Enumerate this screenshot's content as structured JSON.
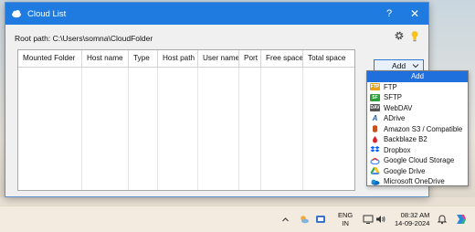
{
  "window": {
    "title": "Cloud List",
    "help_label": "?",
    "close_label": "✕"
  },
  "root_path": "Root path: C:\\Users\\somna\\CloudFolder",
  "table": {
    "columns": [
      "Mounted Folder",
      "Host name",
      "Type",
      "Host path",
      "User name",
      "Port",
      "Free space",
      "Total space"
    ]
  },
  "add_button": {
    "label": "Add"
  },
  "dropdown": {
    "items": [
      {
        "label": "Add",
        "icon": "none",
        "selected": true
      },
      {
        "label": "FTP",
        "icon": "ftp-icon",
        "color": "#e8a317"
      },
      {
        "label": "SFTP",
        "icon": "sftp-icon",
        "color": "#2e9e3a"
      },
      {
        "label": "WebDAV",
        "icon": "webdav-icon",
        "color": "#555555"
      },
      {
        "label": "ADrive",
        "icon": "adrive-icon",
        "color": "#1a5fb4"
      },
      {
        "label": "Amazon S3 / Compatible",
        "icon": "amazon-s3-icon",
        "color": "#c7511f"
      },
      {
        "label": "Backblaze B2",
        "icon": "backblaze-icon",
        "color": "#d9252a"
      },
      {
        "label": "Dropbox",
        "icon": "dropbox-icon",
        "color": "#0061fe"
      },
      {
        "label": "Google Cloud Storage",
        "icon": "google-cloud-icon",
        "color": "#4285f4"
      },
      {
        "label": "Google Drive",
        "icon": "google-drive-icon",
        "color": "#34a853"
      },
      {
        "label": "Microsoft OneDrive",
        "icon": "onedrive-icon",
        "color": "#0364b8"
      }
    ]
  },
  "taskbar": {
    "lang_top": "ENG",
    "lang_bottom": "IN",
    "time": "08:32 AM",
    "date": "14-09-2024"
  },
  "colors": {
    "titlebar": "#1f7be0",
    "selection": "#1f6fdc"
  }
}
